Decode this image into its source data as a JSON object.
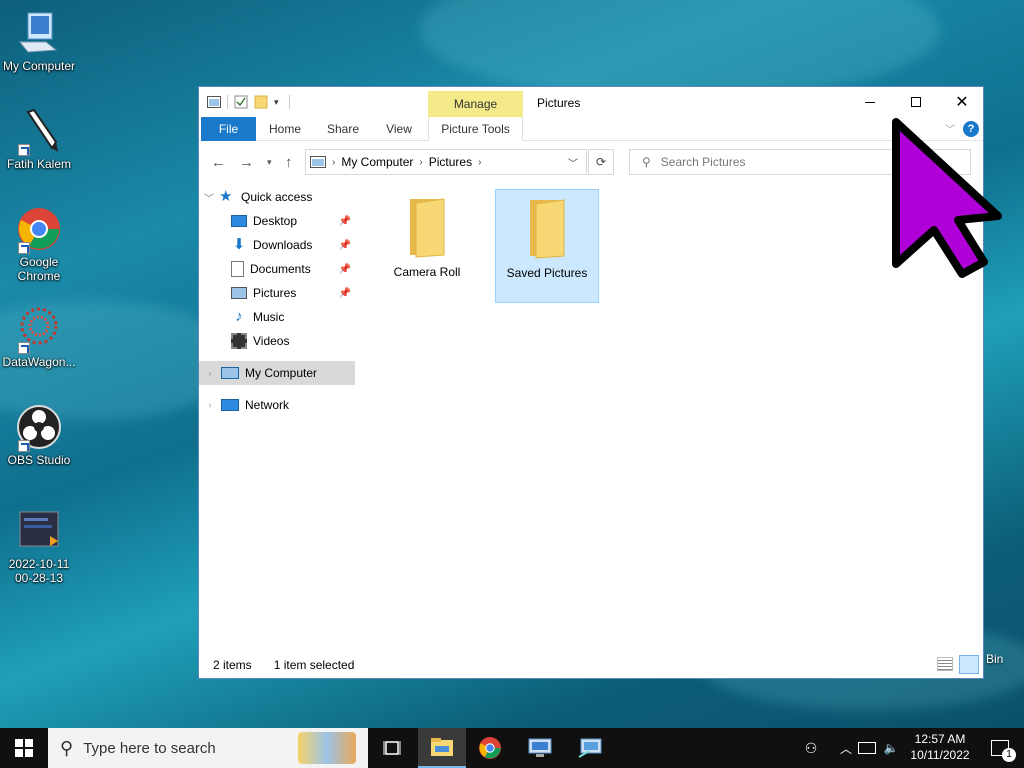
{
  "desktop": {
    "icons": [
      {
        "label": "My Computer"
      },
      {
        "label": "Fatih Kalem"
      },
      {
        "label": "Google Chrome"
      },
      {
        "label": "DataWagon..."
      },
      {
        "label": "OBS Studio"
      },
      {
        "label": "2022-10-11 00-28-13"
      }
    ],
    "recycle_bin_partial": "Bin"
  },
  "window": {
    "title": "Pictures",
    "contextual_tab": "Manage",
    "ribbon_tabs": [
      "File",
      "Home",
      "Share",
      "View",
      "Picture Tools"
    ],
    "address": {
      "crumbs": [
        "My Computer",
        "Pictures"
      ]
    },
    "search_placeholder": "Search Pictures",
    "sidebar": {
      "quick_access": "Quick access",
      "items": [
        "Desktop",
        "Downloads",
        "Documents",
        "Pictures",
        "Music",
        "Videos"
      ],
      "my_computer": "My Computer",
      "network": "Network"
    },
    "files": [
      "Camera Roll",
      "Saved Pictures"
    ],
    "status": {
      "count": "2 items",
      "selection": "1 item selected"
    }
  },
  "taskbar": {
    "search_placeholder": "Type here to search",
    "time": "12:57 AM",
    "date": "10/11/2022",
    "notification_count": "1"
  },
  "colors": {
    "accent": "#1979ca",
    "manage_tab": "#f5ea8a",
    "selection": "#cce8ff",
    "cursor": "#b000d8"
  }
}
